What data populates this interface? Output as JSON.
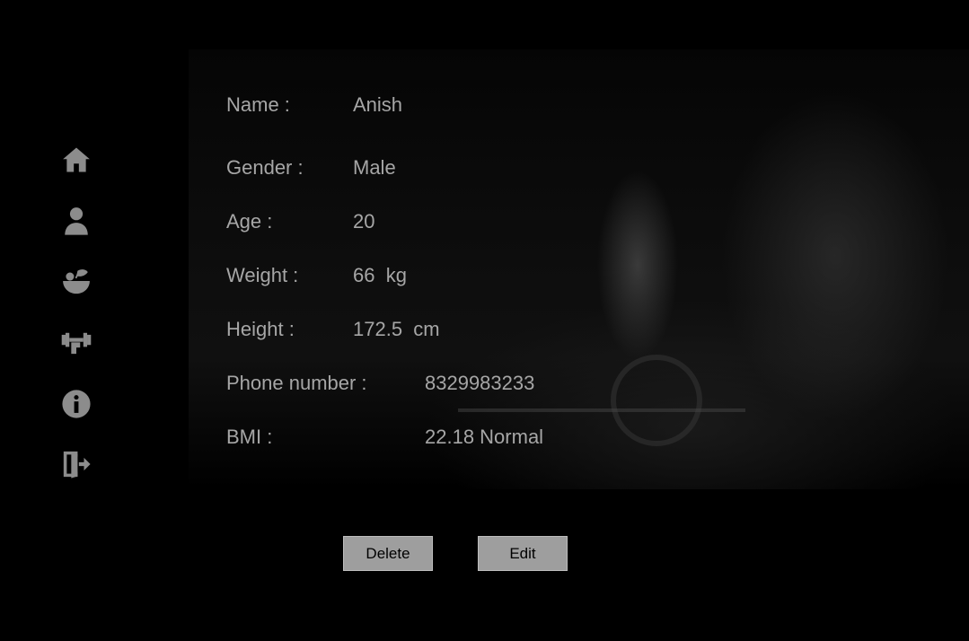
{
  "nav": {
    "items": [
      {
        "icon": "home-icon"
      },
      {
        "icon": "user-icon"
      },
      {
        "icon": "diet-bowl-icon"
      },
      {
        "icon": "workout-icon"
      },
      {
        "icon": "info-icon"
      },
      {
        "icon": "logout-icon"
      }
    ]
  },
  "profile": {
    "name_label": "Name :",
    "name_value": "Anish",
    "gender_label": "Gender :",
    "gender_value": "Male",
    "age_label": "Age :",
    "age_value": "20",
    "weight_label": "Weight :",
    "weight_value": "66  kg",
    "height_label": "Height :",
    "height_value": "172.5  cm",
    "phone_label": "Phone number :",
    "phone_value": "8329983233",
    "bmi_label": "BMI :",
    "bmi_value": "22.18 Normal"
  },
  "actions": {
    "delete_label": "Delete",
    "edit_label": "Edit"
  },
  "colors": {
    "background": "#000000",
    "text": "#a6a6a6",
    "icon": "#8c8c8c",
    "button": "#9e9e9e"
  }
}
